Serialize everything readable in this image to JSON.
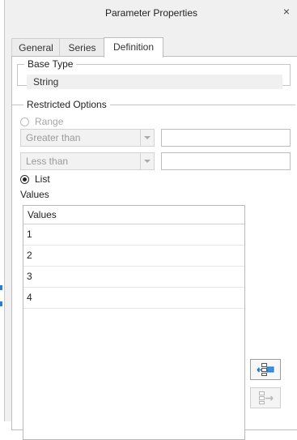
{
  "dialog": {
    "title": "Parameter Properties",
    "close_glyph": "×"
  },
  "tabs": [
    {
      "label": "General",
      "active": false
    },
    {
      "label": "Series",
      "active": false
    },
    {
      "label": "Definition",
      "active": true
    }
  ],
  "base_type": {
    "legend": "Base Type",
    "value": "String"
  },
  "restricted_options": {
    "legend": "Restricted Options",
    "range": {
      "label": "Range",
      "selected": false,
      "enabled": false,
      "lower_operator": "Greater than",
      "lower_value": "",
      "upper_operator": "Less than",
      "upper_value": ""
    },
    "list": {
      "label": "List",
      "selected": true
    },
    "values_label": "Values",
    "values_table": {
      "header": "Values",
      "rows": [
        "1",
        "2",
        "3",
        "4"
      ]
    },
    "buttons": [
      {
        "name": "add-value-icon",
        "enabled": true
      },
      {
        "name": "remove-value-icon",
        "enabled": false
      }
    ]
  },
  "colors": {
    "accent": "#1a73c7",
    "dialog_bg": "#f0f0f0",
    "panel_bg": "#ffffff",
    "disabled_text": "#a7a7a7"
  }
}
